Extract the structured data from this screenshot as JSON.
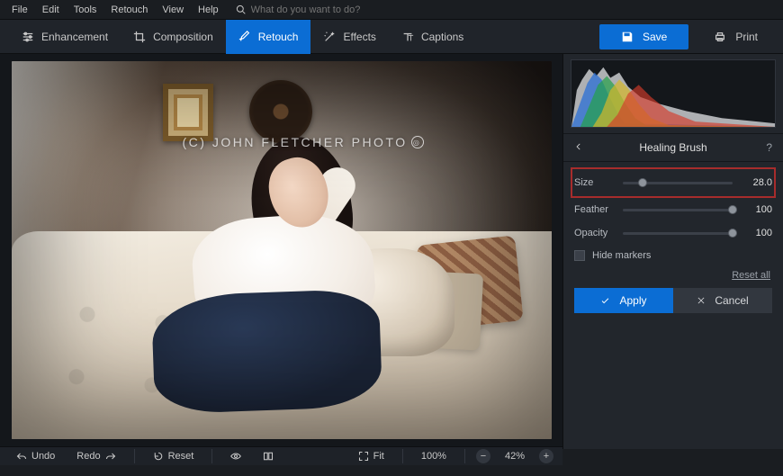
{
  "menubar": {
    "items": [
      "File",
      "Edit",
      "Tools",
      "Retouch",
      "View",
      "Help"
    ],
    "search_placeholder": "What do you want to do?"
  },
  "toolbar": {
    "tabs": [
      {
        "label": "Enhancement",
        "active": false
      },
      {
        "label": "Composition",
        "active": false
      },
      {
        "label": "Retouch",
        "active": true
      },
      {
        "label": "Effects",
        "active": false
      },
      {
        "label": "Captions",
        "active": false
      }
    ],
    "save_label": "Save",
    "print_label": "Print"
  },
  "canvas": {
    "watermark": "(C) JOHN FLETCHER PHOTO"
  },
  "bottombar": {
    "undo": "Undo",
    "redo": "Redo",
    "reset": "Reset",
    "fit": "Fit",
    "zoom_main": "100%",
    "zoom_secondary": "42%"
  },
  "panel": {
    "title": "Healing Brush",
    "sliders": [
      {
        "label": "Size",
        "value": "28.0",
        "percent": 18,
        "highlighted": true
      },
      {
        "label": "Feather",
        "value": "100",
        "percent": 100,
        "highlighted": false
      },
      {
        "label": "Opacity",
        "value": "100",
        "percent": 100,
        "highlighted": false
      }
    ],
    "hide_markers": "Hide markers",
    "reset_all": "Reset all",
    "apply": "Apply",
    "cancel": "Cancel"
  },
  "colors": {
    "accent": "#0b6dd4",
    "highlight_box": "#a72c2c",
    "panel_bg": "#22262c"
  }
}
